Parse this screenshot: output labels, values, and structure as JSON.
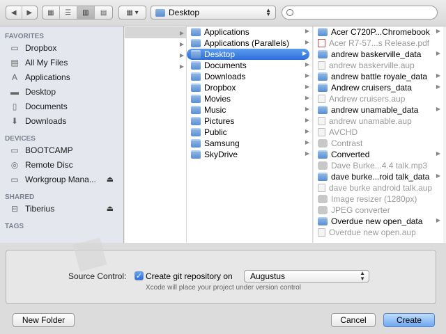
{
  "toolbar": {
    "nav_back": "◀",
    "nav_forward": "▶",
    "view_icons": "▦",
    "view_list": "☰",
    "view_columns": "▥",
    "view_coverflow": "▤",
    "arrange": "▦ ▾",
    "location": "Desktop",
    "search_placeholder": ""
  },
  "sidebar": {
    "favorites_header": "FAVORITES",
    "favorites": [
      {
        "label": "Dropbox",
        "icon": "folder-icon"
      },
      {
        "label": "All My Files",
        "icon": "all-files-icon"
      },
      {
        "label": "Applications",
        "icon": "applications-icon"
      },
      {
        "label": "Desktop",
        "icon": "desktop-icon"
      },
      {
        "label": "Documents",
        "icon": "documents-icon"
      },
      {
        "label": "Downloads",
        "icon": "downloads-icon"
      }
    ],
    "devices_header": "DEVICES",
    "devices": [
      {
        "label": "BOOTCAMP",
        "icon": "drive-icon"
      },
      {
        "label": "Remote Disc",
        "icon": "disc-icon"
      },
      {
        "label": "Workgroup Mana...",
        "icon": "drive-icon",
        "eject": "⏏"
      }
    ],
    "shared_header": "SHARED",
    "shared": [
      {
        "label": "Tiberius",
        "icon": "network-icon",
        "eject": "⏏"
      }
    ],
    "tags_header": "TAGS"
  },
  "column2": [
    {
      "label": "Applications",
      "kind": "folder",
      "arrow": true
    },
    {
      "label": "Applications (Parallels)",
      "kind": "folder",
      "arrow": true
    },
    {
      "label": "Desktop",
      "kind": "folder",
      "arrow": true,
      "selected": true
    },
    {
      "label": "Documents",
      "kind": "folder",
      "arrow": true
    },
    {
      "label": "Downloads",
      "kind": "folder",
      "arrow": true
    },
    {
      "label": "Dropbox",
      "kind": "folder",
      "arrow": true
    },
    {
      "label": "Movies",
      "kind": "folder",
      "arrow": true
    },
    {
      "label": "Music",
      "kind": "folder",
      "arrow": true
    },
    {
      "label": "Pictures",
      "kind": "folder",
      "arrow": true
    },
    {
      "label": "Public",
      "kind": "folder",
      "arrow": true
    },
    {
      "label": "Samsung",
      "kind": "folder",
      "arrow": true
    },
    {
      "label": "SkyDrive",
      "kind": "folder",
      "arrow": true
    }
  ],
  "column3": [
    {
      "label": "Acer C720P...Chromebook",
      "kind": "folder",
      "arrow": true,
      "dim": false
    },
    {
      "label": "Acer R7-57...s Release.pdf",
      "kind": "pdf",
      "arrow": false,
      "dim": true
    },
    {
      "label": "andrew baskerville_data",
      "kind": "folder",
      "arrow": true,
      "dim": false
    },
    {
      "label": "andrew baskerville.aup",
      "kind": "doc",
      "arrow": false,
      "dim": true
    },
    {
      "label": "andrew battle royale_data",
      "kind": "folder",
      "arrow": true,
      "dim": false
    },
    {
      "label": "Andrew cruisers_data",
      "kind": "folder",
      "arrow": true,
      "dim": false
    },
    {
      "label": "Andrew cruisers.aup",
      "kind": "doc",
      "arrow": false,
      "dim": true
    },
    {
      "label": "andrew unamable_data",
      "kind": "folder",
      "arrow": true,
      "dim": false
    },
    {
      "label": "andrew unamable.aup",
      "kind": "doc",
      "arrow": false,
      "dim": true
    },
    {
      "label": "AVCHD",
      "kind": "doc",
      "arrow": false,
      "dim": true
    },
    {
      "label": "Contrast",
      "kind": "app",
      "arrow": false,
      "dim": true
    },
    {
      "label": "Converted",
      "kind": "folder",
      "arrow": true,
      "dim": false
    },
    {
      "label": "Dave Burke...4.4 talk.mp3",
      "kind": "app",
      "arrow": false,
      "dim": true
    },
    {
      "label": "dave burke...roid talk_data",
      "kind": "folder",
      "arrow": true,
      "dim": false
    },
    {
      "label": "dave burke android talk.aup",
      "kind": "doc",
      "arrow": false,
      "dim": true
    },
    {
      "label": "Image resizer (1280px)",
      "kind": "app",
      "arrow": false,
      "dim": true
    },
    {
      "label": "JPEG converter",
      "kind": "app",
      "arrow": false,
      "dim": true
    },
    {
      "label": "Overdue new open_data",
      "kind": "folder",
      "arrow": true,
      "dim": false
    },
    {
      "label": "Overdue new open.aup",
      "kind": "doc",
      "arrow": false,
      "dim": true
    }
  ],
  "source_control": {
    "label": "Source Control:",
    "checkbox_label": "Create git repository on",
    "checked": true,
    "repository": "Augustus",
    "hint": "Xcode will place your project under version control"
  },
  "buttons": {
    "new_folder": "New Folder",
    "cancel": "Cancel",
    "create": "Create"
  }
}
